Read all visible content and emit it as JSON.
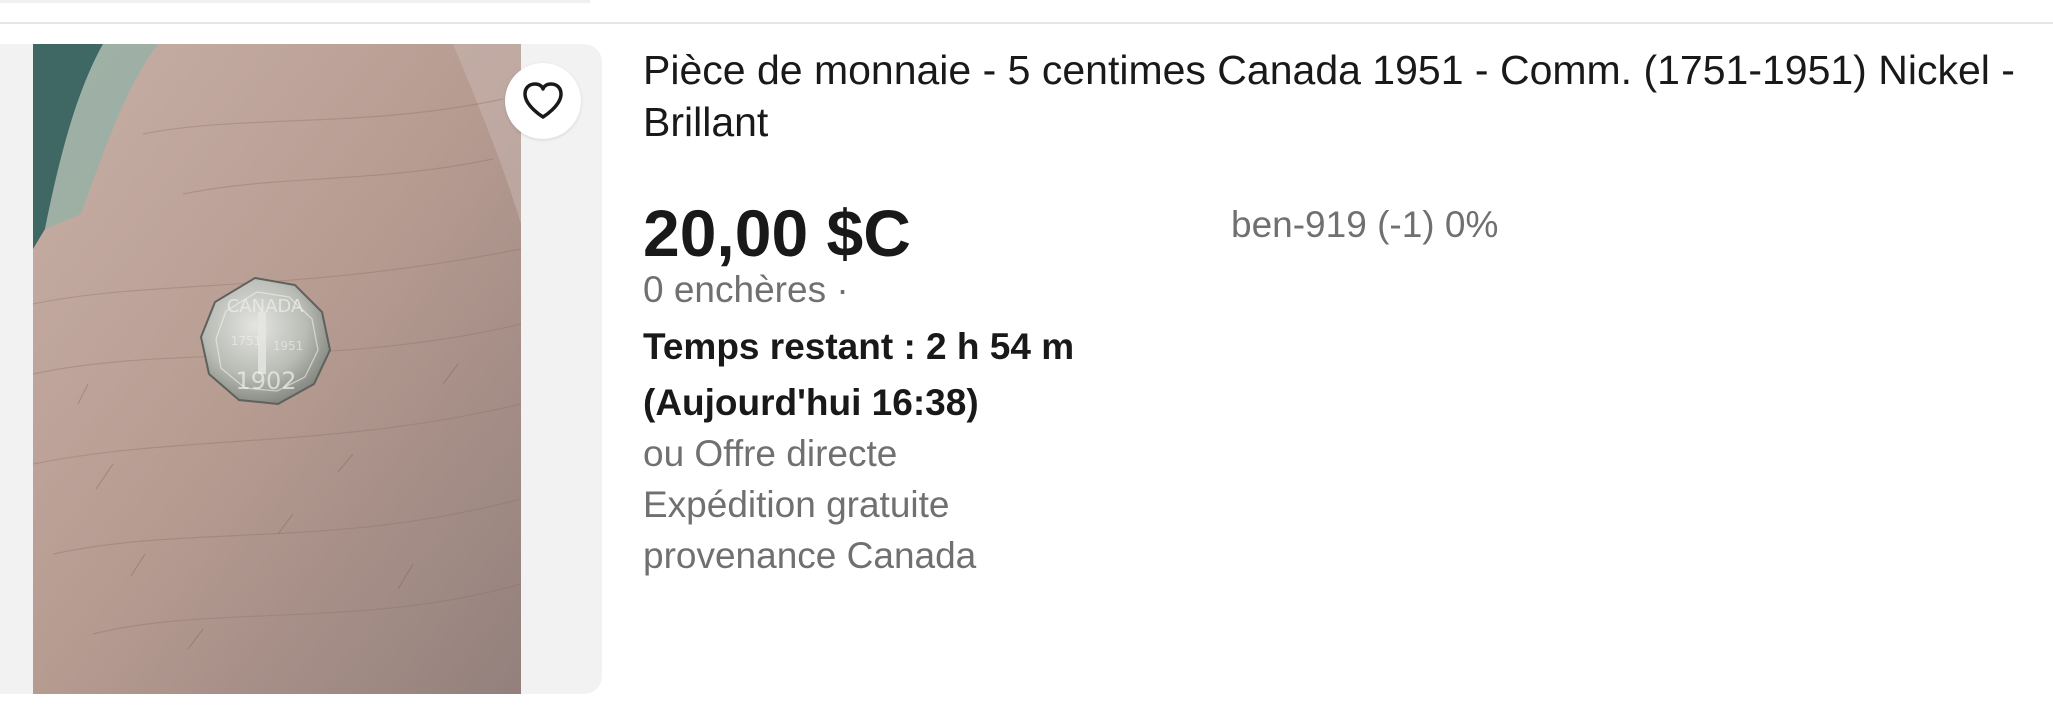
{
  "listing": {
    "title": "Pièce de monnaie - 5 centimes Canada 1951 - Comm. (1751-1951) Nickel - Brillant",
    "price": "20,00 $C",
    "seller": "ben-919 (-1) 0%",
    "bids": "0 enchères ·",
    "time_left": "Temps restant : 2 h 54 m",
    "end_time": "(Aujourd'hui 16:38)",
    "offer": "ou Offre directe",
    "shipping": "Expédition gratuite",
    "origin": "provenance Canada",
    "watch_icon": "heart-icon",
    "image_icon": "coin-photo"
  },
  "colors": {
    "primary_text": "#191919",
    "secondary_text": "#707070",
    "image_background": "#f2f2f2",
    "divider": "#e5e5e5"
  }
}
